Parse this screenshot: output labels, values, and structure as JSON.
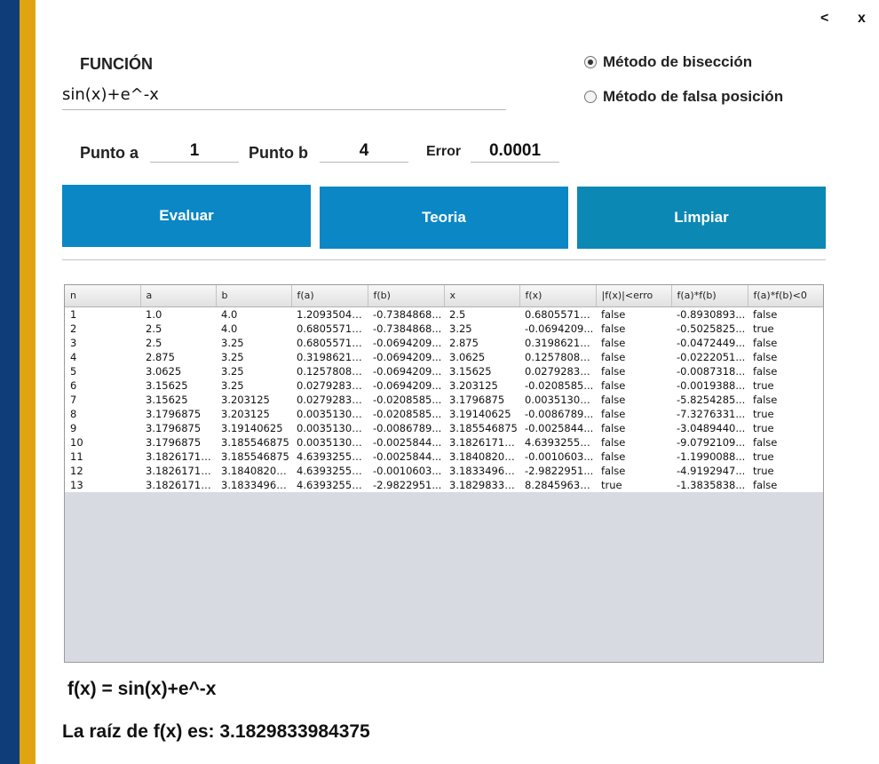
{
  "window": {
    "back_label": "<",
    "close_label": "x"
  },
  "function": {
    "label": "FUNCIÓN",
    "value": "sin(x)+e^-x"
  },
  "methods": [
    {
      "label": "Método de bisección",
      "selected": true
    },
    {
      "label": "Método de falsa posición",
      "selected": false
    }
  ],
  "params": {
    "a_label": "Punto a",
    "a_value": "1",
    "b_label": "Punto b",
    "b_value": "4",
    "error_label": "Error",
    "error_value": "0.0001"
  },
  "buttons": {
    "evaluar": "Evaluar",
    "teoria": "Teoria",
    "limpiar": "Limpiar"
  },
  "table": {
    "columns": [
      "n",
      "a",
      "b",
      "f(a)",
      "f(b)",
      "x",
      "f(x)",
      "|f(x)|<erro",
      "f(a)*f(b)",
      "f(a)*f(b)<0"
    ],
    "rows": [
      [
        "1",
        "1.0",
        "4.0",
        "1.20935042...",
        "-0.7384868...",
        "2.5",
        "0.68055714...",
        "false",
        "-0.8930893...",
        "false"
      ],
      [
        "2",
        "2.5",
        "4.0",
        "0.68055714...",
        "-0.7384868...",
        "3.25",
        "-0.0694209...",
        "false",
        "-0.5025825...",
        "true"
      ],
      [
        "3",
        "2.5",
        "3.25",
        "0.68055714...",
        "-0.0694209...",
        "2.875",
        "0.31986213...",
        "false",
        "-0.0472449...",
        "false"
      ],
      [
        "4",
        "2.875",
        "3.25",
        "0.31986213...",
        "-0.0694209...",
        "3.0625",
        "0.12578083...",
        "false",
        "-0.0222051...",
        "false"
      ],
      [
        "5",
        "3.0625",
        "3.25",
        "0.12578083...",
        "-0.0694209...",
        "3.15625",
        "0.02792831...",
        "false",
        "-0.0087318...",
        "false"
      ],
      [
        "6",
        "3.15625",
        "3.25",
        "0.02792831...",
        "-0.0694209...",
        "3.203125",
        "-0.0208585...",
        "false",
        "-0.0019388...",
        "true"
      ],
      [
        "7",
        "3.15625",
        "3.203125",
        "0.02792831...",
        "-0.0208585...",
        "3.1796875",
        "0.00351301...",
        "false",
        "-5.8254285...",
        "false"
      ],
      [
        "8",
        "3.1796875",
        "3.203125",
        "0.00351301...",
        "-0.0208585...",
        "3.19140625",
        "-0.0086789...",
        "false",
        "-7.3276331...",
        "true"
      ],
      [
        "9",
        "3.1796875",
        "3.19140625",
        "0.00351301...",
        "-0.0086789...",
        "3.185546875",
        "-0.0025844...",
        "false",
        "-3.0489440...",
        "true"
      ],
      [
        "10",
        "3.1796875",
        "3.185546875",
        "0.00351301...",
        "-0.0025844...",
        "3.18261718...",
        "4.63932552...",
        "false",
        "-9.0792109...",
        "false"
      ],
      [
        "11",
        "3.18261718...",
        "3.185546875",
        "4.63932552...",
        "-0.0025844...",
        "3.18408203...",
        "-0.0010603...",
        "false",
        "-1.1990088...",
        "true"
      ],
      [
        "12",
        "3.18261718...",
        "3.18408203...",
        "4.63932552...",
        "-0.0010603...",
        "3.18334960...",
        "-2.9822951...",
        "false",
        "-4.9192947...",
        "true"
      ],
      [
        "13",
        "3.18261718...",
        "3.18334960...",
        "4.63932552...",
        "-2.9822951...",
        "3.18298339...",
        "8.28459630...",
        "true",
        "-1.3835838...",
        "false"
      ]
    ]
  },
  "result": {
    "fx_text": "f(x) = sin(x)+e^-x",
    "root_text": "La raíz de f(x) es: 3.1829833984375"
  },
  "colors": {
    "stripe_blue": "#0f3d7a",
    "stripe_gold": "#e0a412",
    "button": "#0b87c5"
  }
}
